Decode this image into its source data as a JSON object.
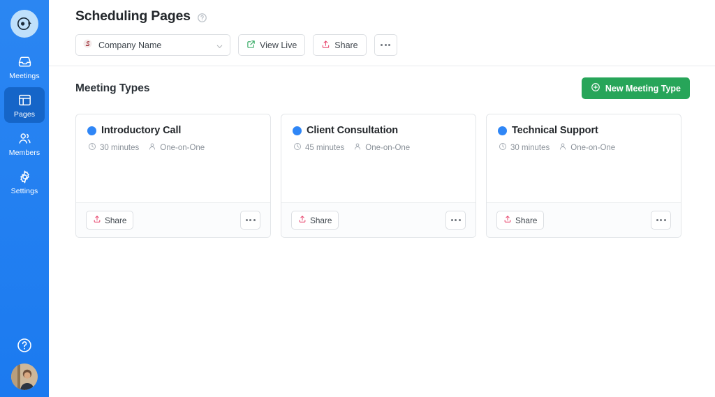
{
  "sidebar": {
    "logo_icon": "app-logo-icon",
    "items": [
      {
        "label": "Meetings",
        "icon": "inbox-icon",
        "active": false
      },
      {
        "label": "Pages",
        "icon": "pages-layout-icon",
        "active": true
      },
      {
        "label": "Members",
        "icon": "users-icon",
        "active": false
      },
      {
        "label": "Settings",
        "icon": "gear-icon",
        "active": false
      }
    ],
    "help_icon": "help-circle-icon",
    "avatar_icon": "user-avatar"
  },
  "header": {
    "title": "Scheduling Pages",
    "help_icon": "help-circle-icon",
    "org_select": {
      "value": "Company Name",
      "logo_icon": "company-s-logo-icon",
      "chevron_icon": "chevron-down-icon"
    },
    "view_live_label": "View Live",
    "view_live_icon": "external-link-icon",
    "share_label": "Share",
    "share_icon": "share-upload-icon",
    "more_icon": "ellipsis-icon"
  },
  "section": {
    "title": "Meeting Types",
    "new_button_label": "New Meeting Type",
    "new_button_icon": "plus-circle-icon"
  },
  "cards": [
    {
      "title": "Introductory Call",
      "dot_color": "#2f86f6",
      "duration": "30 minutes",
      "duration_icon": "clock-icon",
      "attendee_type": "One-on-One",
      "attendee_icon": "person-icon",
      "share_label": "Share",
      "share_icon": "share-upload-icon",
      "more_icon": "ellipsis-icon"
    },
    {
      "title": "Client Consultation",
      "dot_color": "#2f86f6",
      "duration": "45 minutes",
      "duration_icon": "clock-icon",
      "attendee_type": "One-on-One",
      "attendee_icon": "person-icon",
      "share_label": "Share",
      "share_icon": "share-upload-icon",
      "more_icon": "ellipsis-icon"
    },
    {
      "title": "Technical Support",
      "dot_color": "#2f86f6",
      "duration": "30 minutes",
      "duration_icon": "clock-icon",
      "attendee_type": "One-on-One",
      "attendee_icon": "person-icon",
      "share_label": "Share",
      "share_icon": "share-upload-icon",
      "more_icon": "ellipsis-icon"
    }
  ],
  "colors": {
    "sidebar_blue": "#1f7ff0",
    "sidebar_active": "#1565c8",
    "accent_green": "#27a559",
    "share_red": "#e8476f",
    "dot_blue": "#2f86f6"
  }
}
